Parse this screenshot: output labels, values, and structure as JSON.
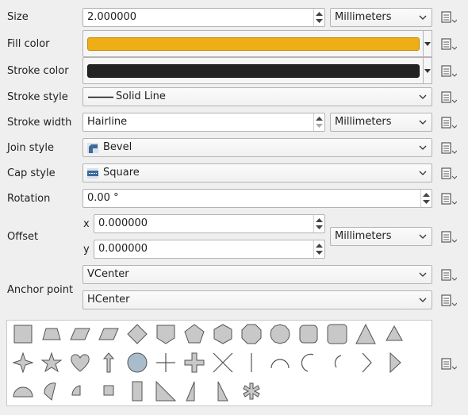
{
  "labels": {
    "size": "Size",
    "fill_color": "Fill color",
    "stroke_color": "Stroke color",
    "stroke_style": "Stroke style",
    "stroke_width": "Stroke width",
    "join_style": "Join style",
    "cap_style": "Cap style",
    "rotation": "Rotation",
    "offset": "Offset",
    "offset_x": "x",
    "offset_y": "y",
    "anchor_point": "Anchor point"
  },
  "fields": {
    "size_value": "2.000000",
    "size_unit": "Millimeters",
    "fill_color": "#efad16",
    "stroke_color": "#232323",
    "stroke_style": "Solid Line",
    "stroke_width_value": "Hairline",
    "stroke_width_unit": "Millimeters",
    "join_style": "Bevel",
    "cap_style": "Square",
    "rotation": "0.00 °",
    "offset_x": "0.000000",
    "offset_y": "0.000000",
    "offset_unit": "Millimeters",
    "anchor_vertical": "VCenter",
    "anchor_horizontal": "HCenter"
  },
  "icons": {
    "data_defined": "data-defined-override-icon",
    "spin": "spin-arrows-icon",
    "dropdown": "chevron-down-icon",
    "join": "bevel-join-icon",
    "cap": "square-cap-icon"
  },
  "colors": {
    "shape_fill": "#c8c8c8",
    "selected_shape_fill": "#a9bccb",
    "stroke": "#555555"
  },
  "palette": {
    "selected": "circle",
    "shapes": [
      "square",
      "trapezoid",
      "parallelogram-right",
      "parallelogram-left",
      "diamond",
      "shield",
      "pentagon",
      "hexagon",
      "octagon",
      "decagon",
      "rounded-square",
      "large-rounded-square",
      "triangle",
      "equilateral-triangle",
      "four-pointed-star",
      "star",
      "heart",
      "arrow",
      "circle",
      "cross",
      "cross-fill",
      "cross2",
      "line",
      "arc",
      "semi-arc",
      "third-arc",
      "arrowhead",
      "filled-arrowhead",
      "half-circle",
      "third-circle",
      "quarter-circle",
      "half-square",
      "square-half-rectangle",
      "right-half-triangle",
      "left-half-triangle",
      "diagonal-half-square",
      "asterisk-fill"
    ]
  }
}
